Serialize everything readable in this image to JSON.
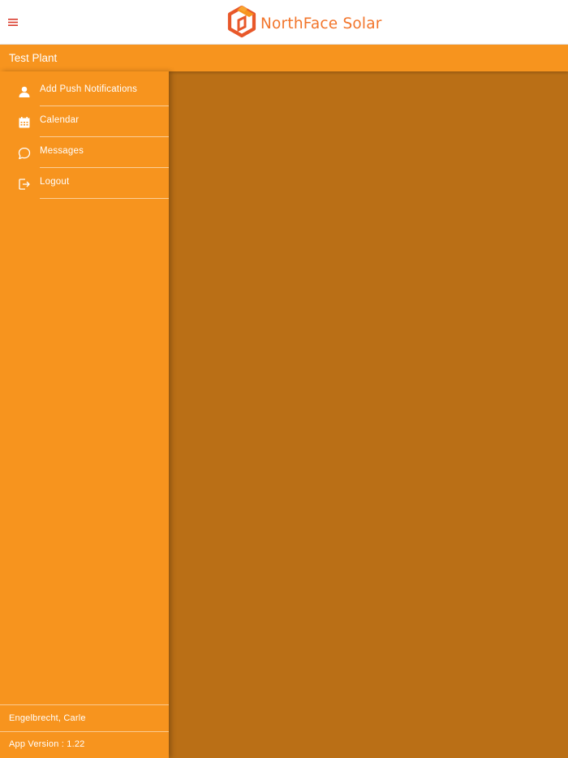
{
  "header": {
    "menu_icon": "hamburger-menu-icon",
    "brand_name": "NorthFace Solar",
    "logo_icon": "house-logo-icon",
    "brand_color": "#f2752b"
  },
  "titlebar": {
    "title": "Test Plant",
    "color": "#f7941e"
  },
  "drawer": {
    "items": [
      {
        "label": "Add Push Notifications",
        "icon": "person-icon"
      },
      {
        "label": "Calendar",
        "icon": "calendar-icon"
      },
      {
        "label": "Messages",
        "icon": "chat-bubble-icon"
      },
      {
        "label": "Logout",
        "icon": "logout-icon"
      }
    ],
    "user_name": "Engelbrecht, Carle",
    "app_version": "App Version : 1.22"
  },
  "colors": {
    "accent": "#f7941e",
    "overlay": "#ba6f16",
    "menu_icon": "#d93a2b"
  }
}
